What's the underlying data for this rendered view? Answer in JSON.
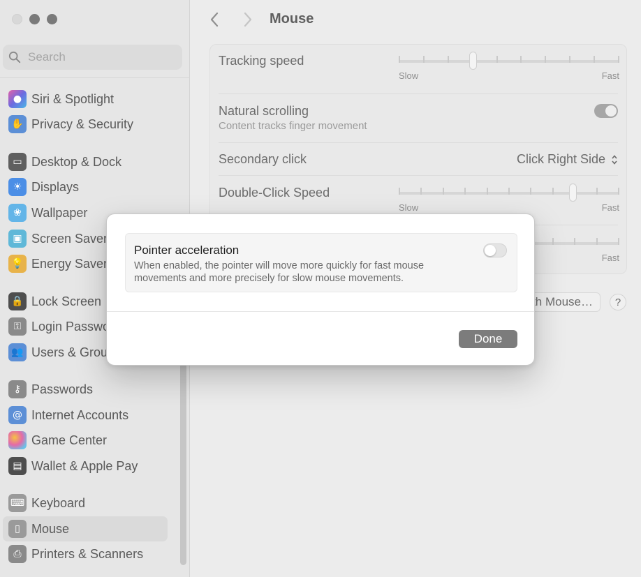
{
  "window": {
    "title": "Mouse"
  },
  "search": {
    "placeholder": "Search"
  },
  "sidebar": {
    "items": [
      {
        "label": "Siri & Spotlight",
        "icon": "siri-icon",
        "color": "#b86bd8"
      },
      {
        "label": "Privacy & Security",
        "icon": "hand-icon",
        "color": "#5c8fd6"
      },
      {
        "label": "Desktop & Dock",
        "icon": "dock-icon",
        "color": "#5f5f5f"
      },
      {
        "label": "Displays",
        "icon": "sun-icon",
        "color": "#4b8ee6"
      },
      {
        "label": "Wallpaper",
        "icon": "flower-icon",
        "color": "#63b5e8"
      },
      {
        "label": "Screen Saver",
        "icon": "screen-saver-icon",
        "color": "#5fb8d8"
      },
      {
        "label": "Energy Saver",
        "icon": "bulb-icon",
        "color": "#e8b34a"
      },
      {
        "label": "Lock Screen",
        "icon": "lock-icon",
        "color": "#4e4e4e"
      },
      {
        "label": "Login Password",
        "icon": "key-icon",
        "color": "#8a8a8a"
      },
      {
        "label": "Users & Groups",
        "icon": "users-icon",
        "color": "#5c8fd6"
      },
      {
        "label": "Passwords",
        "icon": "passwords-icon",
        "color": "#8a8a8a"
      },
      {
        "label": "Internet Accounts",
        "icon": "at-icon",
        "color": "#5c8fd6"
      },
      {
        "label": "Game Center",
        "icon": "game-center-icon",
        "color": "#d97ab8"
      },
      {
        "label": "Wallet & Apple Pay",
        "icon": "wallet-icon",
        "color": "#4e4e4e"
      },
      {
        "label": "Keyboard",
        "icon": "keyboard-icon",
        "color": "#9a9a9a"
      },
      {
        "label": "Mouse",
        "icon": "mouse-icon",
        "color": "#9a9a9a"
      },
      {
        "label": "Printers & Scanners",
        "icon": "printer-icon",
        "color": "#8a8a8a"
      }
    ]
  },
  "settings": {
    "tracking_speed": {
      "label": "Tracking speed",
      "min_label": "Slow",
      "max_label": "Fast",
      "value": 0.33
    },
    "natural_scrolling": {
      "label": "Natural scrolling",
      "sublabel": "Content tracks finger movement",
      "enabled": true
    },
    "secondary_click": {
      "label": "Secondary click",
      "value": "Click Right Side"
    },
    "double_click_speed": {
      "label": "Double-Click Speed",
      "min_label": "Slow",
      "max_label": "Fast",
      "value": 0.8
    },
    "scrolling_speed": {
      "max_label": "Fast"
    }
  },
  "footer": {
    "pair_button_label": "Set Up Bluetooth Mouse…",
    "help_label": "?"
  },
  "dialog": {
    "option_title": "Pointer acceleration",
    "option_description": "When enabled, the pointer will move more quickly for fast mouse movements and more precisely for slow mouse movements.",
    "enabled": false,
    "done_label": "Done"
  }
}
